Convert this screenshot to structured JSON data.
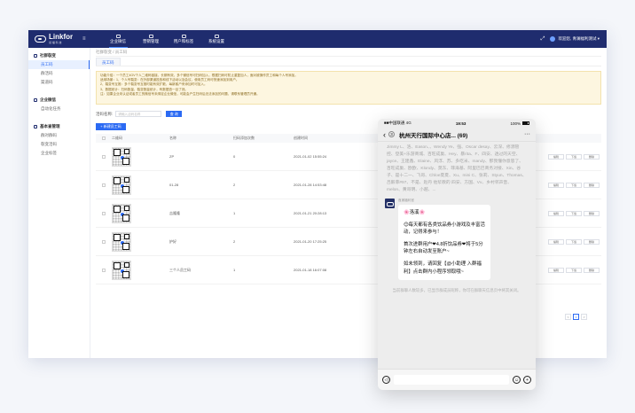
{
  "app": {
    "logo": "Linkfor",
    "logo_sub": "领 福 科 技",
    "menu_icon": "menu-icon"
  },
  "nav": [
    {
      "label": "企业微信",
      "icon": "wecom-icon"
    },
    {
      "label": "营销管理",
      "icon": "marketing-icon"
    },
    {
      "label": "用户和标签",
      "icon": "tag-icon"
    },
    {
      "label": "系统设置",
      "icon": "settings-icon"
    }
  ],
  "user": {
    "text": "欢迎您, 青澜福利测试 ▾",
    "expand_icon": "expand-icon"
  },
  "sidebar": [
    {
      "title": "社群裂变",
      "items": [
        "员工码",
        "群活码",
        "渠道码"
      ]
    },
    {
      "title": "企业微信",
      "items": [
        "自动化任务"
      ]
    },
    {
      "title": "基本查管理",
      "items": [
        "群对群码",
        "裂变活码",
        "企业标签"
      ]
    }
  ],
  "breadcrumb": "社群裂变 / 员工码",
  "tab": "员工码",
  "notice": [
    "功能介绍：一个员工4GV个人二维码链接，长期有效，多个微信号可扫码加入，根据扫码可防止重复加人，面对被操作员工和每个人号添加。",
    "适用场景：1、个人号裂变：在外部渠道投放和线下活动以及会议，使用员工码可快速添加到用户。",
    "2、裂变号互推：多个裂变号互推时能有效扩散，每新客户来添加时可加入。",
    "3、数据统计：扫码数量、裂变数量统计，有数据查一目了然。",
    "注：如果企业未认证或者员工的微信号未绑定企业微信，可能会产生扫码后无法添加的问题，请联系管理员开通。"
  ],
  "filter": {
    "label": "活码名称:",
    "placeholder": "请输入活码名称",
    "query": "查 询"
  },
  "new_button": "+ 新建员工码",
  "columns": [
    "二维码",
    "名称",
    "扫码添加次数",
    "创建时间"
  ],
  "rows": [
    {
      "name": "ZP",
      "count": "0",
      "time": "2021-01-02 15:55:24"
    },
    {
      "name": "01-28",
      "count": "2",
      "time": "2021-01-28 14:53:48"
    },
    {
      "name": "吉隆隆",
      "count": "1",
      "time": "2021-01-21 20:28:13"
    },
    {
      "name": "护好",
      "count": "2",
      "time": "2021-01-20 17:25:25"
    },
    {
      "name": "三个人员工码",
      "count": "1",
      "time": "2021-01-18 16:07:08"
    }
  ],
  "row_actions": [
    "编辑",
    "下载",
    "删除"
  ],
  "pager": [
    "<",
    "1",
    ">"
  ],
  "phone": {
    "carrier": "■■中国联通 4G",
    "time": "19:53",
    "battery": "100%",
    "title": "杭州天行国际中心店... (69)",
    "back_count": "3",
    "system_text": "Jimmy L、洛、Eason、、Wendy Ye、强、Oscar desay、云深、修源管控、登美+乐游商城、百旺成巢、Hey、暴rita、F、四安、透过的天空、jayce、王建鑫、Elaine、风浮、苏、多吃米、mandy、那我懂你意思了、百旺成巢、欧欧、Klondy、莫东、菲海基、阿里巴巴商务对接、Xin、谷子、是十二一、飞哥、Chloe夏夏、Xu、mini C、张莉、Styun、Thomas、吕毅菲#97、不是、赵丹 他浆教的 四安、方国、Vv、乡村邻声音、melon、黄哥明、小越、...",
    "sender": "首席福利官",
    "bubble": [
      "🌸洛溪🌸",
      "😊每天都有各类饮品券小游戏及丰富活动，记得来参与！",
      "首次进群用户❤4.8折饮品券❤将于5分钟左右自动发至账户~",
      "如未领到，请回复【@小助理 入群福利】点击群内小程序领取哦~"
    ],
    "footer_note": "当前群聊人数较多，已显示群成员昵称，你可在群聊天信息页中将其关闭。",
    "voice_icon": "voice-icon",
    "emoji_icon": "emoji-icon",
    "plus_icon": "plus-icon"
  }
}
